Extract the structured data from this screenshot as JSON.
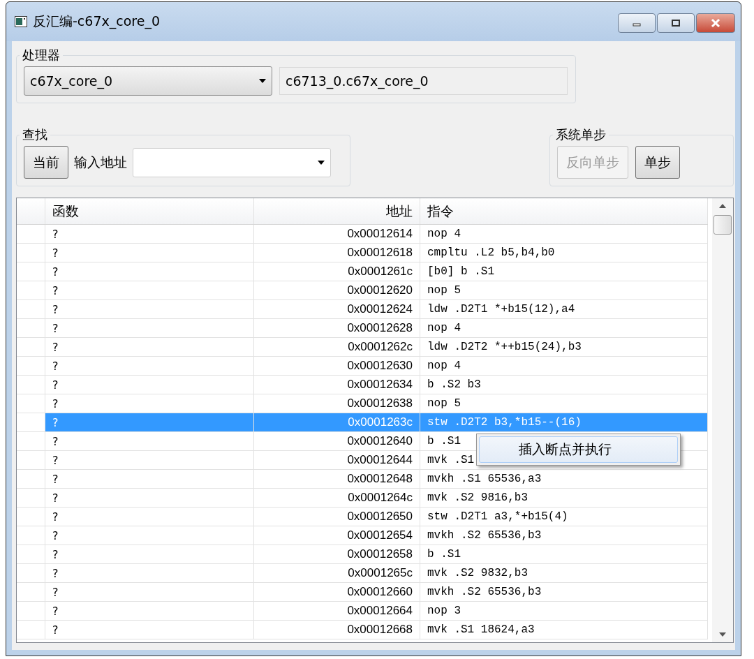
{
  "window": {
    "title": "反汇编-c67x_core_0"
  },
  "processor_group": {
    "label": "处理器",
    "selector": {
      "value": "c67x_core_0"
    },
    "full_name": {
      "value": "c6713_0.c67x_core_0"
    }
  },
  "find_group": {
    "label": "查找",
    "current_button": {
      "label": "当前",
      "disabled": false
    },
    "address_label": "输入地址"
  },
  "step_group": {
    "label": "系统单步",
    "buttons": [
      {
        "label": "反向单步",
        "disabled": true
      },
      {
        "label": "单步",
        "disabled": false
      }
    ]
  },
  "table": {
    "columns": [
      "函数",
      "地址",
      "指令"
    ],
    "rows": [
      {
        "function": "?",
        "address": "0x00012614",
        "instruction": "nop 4",
        "selected": false
      },
      {
        "function": "?",
        "address": "0x00012618",
        "instruction": "cmpltu .L2 b5,b4,b0",
        "selected": false
      },
      {
        "function": "?",
        "address": "0x0001261c",
        "instruction": "[b0] b .S1",
        "selected": false
      },
      {
        "function": "?",
        "address": "0x00012620",
        "instruction": "nop 5",
        "selected": false
      },
      {
        "function": "?",
        "address": "0x00012624",
        "instruction": "ldw .D2T1 *+b15(12),a4",
        "selected": false
      },
      {
        "function": "?",
        "address": "0x00012628",
        "instruction": "nop 4",
        "selected": false
      },
      {
        "function": "?",
        "address": "0x0001262c",
        "instruction": "ldw .D2T2 *++b15(24),b3",
        "selected": false
      },
      {
        "function": "?",
        "address": "0x00012630",
        "instruction": "nop 4",
        "selected": false
      },
      {
        "function": "?",
        "address": "0x00012634",
        "instruction": "b .S2 b3",
        "selected": false
      },
      {
        "function": "?",
        "address": "0x00012638",
        "instruction": "nop 5",
        "selected": false
      },
      {
        "function": "?",
        "address": "0x0001263c",
        "instruction": "stw .D2T2 b3,*b15--(16)",
        "selected": true
      },
      {
        "function": "?",
        "address": "0x00012640",
        "instruction": "b .S1",
        "selected": false
      },
      {
        "function": "?",
        "address": "0x00012644",
        "instruction": "mvk .S1",
        "selected": false
      },
      {
        "function": "?",
        "address": "0x00012648",
        "instruction": "mvkh .S1 65536,a3",
        "selected": false
      },
      {
        "function": "?",
        "address": "0x0001264c",
        "instruction": "mvk .S2 9816,b3",
        "selected": false
      },
      {
        "function": "?",
        "address": "0x00012650",
        "instruction": "stw .D2T1 a3,*+b15(4)",
        "selected": false
      },
      {
        "function": "?",
        "address": "0x00012654",
        "instruction": "mvkh .S2 65536,b3",
        "selected": false
      },
      {
        "function": "?",
        "address": "0x00012658",
        "instruction": "b .S1",
        "selected": false
      },
      {
        "function": "?",
        "address": "0x0001265c",
        "instruction": "mvk .S2 9832,b3",
        "selected": false
      },
      {
        "function": "?",
        "address": "0x00012660",
        "instruction": "mvkh .S2 65536,b3",
        "selected": false
      },
      {
        "function": "?",
        "address": "0x00012664",
        "instruction": "nop 3",
        "selected": false
      },
      {
        "function": "?",
        "address": "0x00012668",
        "instruction": "mvk .S1 18624,a3",
        "selected": false
      }
    ]
  },
  "context_menu": {
    "items": [
      {
        "label": "插入断点并执行",
        "selected": true
      }
    ]
  }
}
